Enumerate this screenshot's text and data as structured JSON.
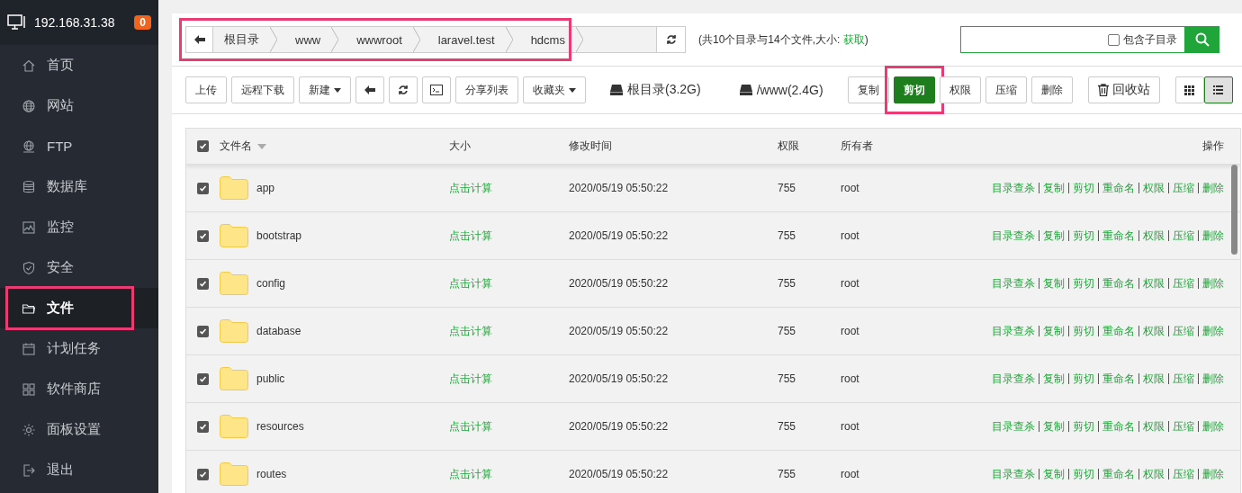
{
  "host": {
    "address": "192.168.31.38",
    "badge": "0"
  },
  "sidebar": {
    "items": [
      {
        "label": "首页",
        "selected": false,
        "highlighted": false
      },
      {
        "label": "网站",
        "selected": false,
        "highlighted": false
      },
      {
        "label": "FTP",
        "selected": false,
        "highlighted": false
      },
      {
        "label": "数据库",
        "selected": false,
        "highlighted": false
      },
      {
        "label": "监控",
        "selected": false,
        "highlighted": false
      },
      {
        "label": "安全",
        "selected": false,
        "highlighted": false
      },
      {
        "label": "文件",
        "selected": true,
        "highlighted": true
      },
      {
        "label": "计划任务",
        "selected": false,
        "highlighted": false
      },
      {
        "label": "软件商店",
        "selected": false,
        "highlighted": false
      },
      {
        "label": "面板设置",
        "selected": false,
        "highlighted": false
      },
      {
        "label": "退出",
        "selected": false,
        "highlighted": false
      }
    ]
  },
  "breadcrumb": {
    "highlighted": true,
    "items": [
      "根目录",
      "www",
      "wwwroot",
      "laravel.test",
      "hdcms"
    ]
  },
  "summary": {
    "before": "(共10个目录与14个文件,大小:",
    "link": "获取",
    "after": ")"
  },
  "search": {
    "option": {
      "label": "包含子目录",
      "checked": false
    }
  },
  "toolbar": {
    "buttons": [
      {
        "kind": "text",
        "label": "上传"
      },
      {
        "kind": "text",
        "label": "远程下载"
      },
      {
        "kind": "dropdown",
        "label": "新建"
      },
      {
        "kind": "back"
      },
      {
        "kind": "refresh"
      },
      {
        "kind": "terminal"
      },
      {
        "kind": "text",
        "label": "分享列表"
      },
      {
        "kind": "dropdown",
        "label": "收藏夹"
      }
    ],
    "disks": [
      "根目录(3.2G)",
      "/www(2.4G)"
    ],
    "actions": [
      {
        "label": "复制",
        "selected": false,
        "highlighted": false
      },
      {
        "label": "剪切",
        "selected": true,
        "highlighted": true
      },
      {
        "label": "权限",
        "selected": false,
        "highlighted": false
      },
      {
        "label": "压缩",
        "selected": false,
        "highlighted": false
      },
      {
        "label": "删除",
        "selected": false,
        "highlighted": false
      }
    ],
    "trash": "回收站",
    "views": [
      {
        "kind": "grid",
        "selected": false
      },
      {
        "kind": "list",
        "selected": true
      }
    ]
  },
  "table": {
    "all_checked": true,
    "columns": [
      "文件名",
      "大小",
      "修改时间",
      "权限",
      "所有者",
      "操作"
    ],
    "rows": [
      {
        "checked": true,
        "name": "app",
        "size": "点击计算",
        "modified": "2020/05/19 05:50:22",
        "permission": "755",
        "owner": "root",
        "actions": [
          "目录查杀",
          "复制",
          "剪切",
          "重命名",
          "权限",
          "压缩",
          "删除"
        ]
      },
      {
        "checked": true,
        "name": "bootstrap",
        "size": "点击计算",
        "modified": "2020/05/19 05:50:22",
        "permission": "755",
        "owner": "root",
        "actions": [
          "目录查杀",
          "复制",
          "剪切",
          "重命名",
          "权限",
          "压缩",
          "删除"
        ]
      },
      {
        "checked": true,
        "name": "config",
        "size": "点击计算",
        "modified": "2020/05/19 05:50:22",
        "permission": "755",
        "owner": "root",
        "actions": [
          "目录查杀",
          "复制",
          "剪切",
          "重命名",
          "权限",
          "压缩",
          "删除"
        ]
      },
      {
        "checked": true,
        "name": "database",
        "size": "点击计算",
        "modified": "2020/05/19 05:50:22",
        "permission": "755",
        "owner": "root",
        "actions": [
          "目录查杀",
          "复制",
          "剪切",
          "重命名",
          "权限",
          "压缩",
          "删除"
        ]
      },
      {
        "checked": true,
        "name": "public",
        "size": "点击计算",
        "modified": "2020/05/19 05:50:22",
        "permission": "755",
        "owner": "root",
        "actions": [
          "目录查杀",
          "复制",
          "剪切",
          "重命名",
          "权限",
          "压缩",
          "删除"
        ]
      },
      {
        "checked": true,
        "name": "resources",
        "size": "点击计算",
        "modified": "2020/05/19 05:50:22",
        "permission": "755",
        "owner": "root",
        "actions": [
          "目录查杀",
          "复制",
          "剪切",
          "重命名",
          "权限",
          "压缩",
          "删除"
        ]
      },
      {
        "checked": true,
        "name": "routes",
        "size": "点击计算",
        "modified": "2020/05/19 05:50:22",
        "permission": "755",
        "owner": "root",
        "actions": [
          "目录查杀",
          "复制",
          "剪切",
          "重命名",
          "权限",
          "压缩",
          "删除"
        ]
      }
    ]
  }
}
